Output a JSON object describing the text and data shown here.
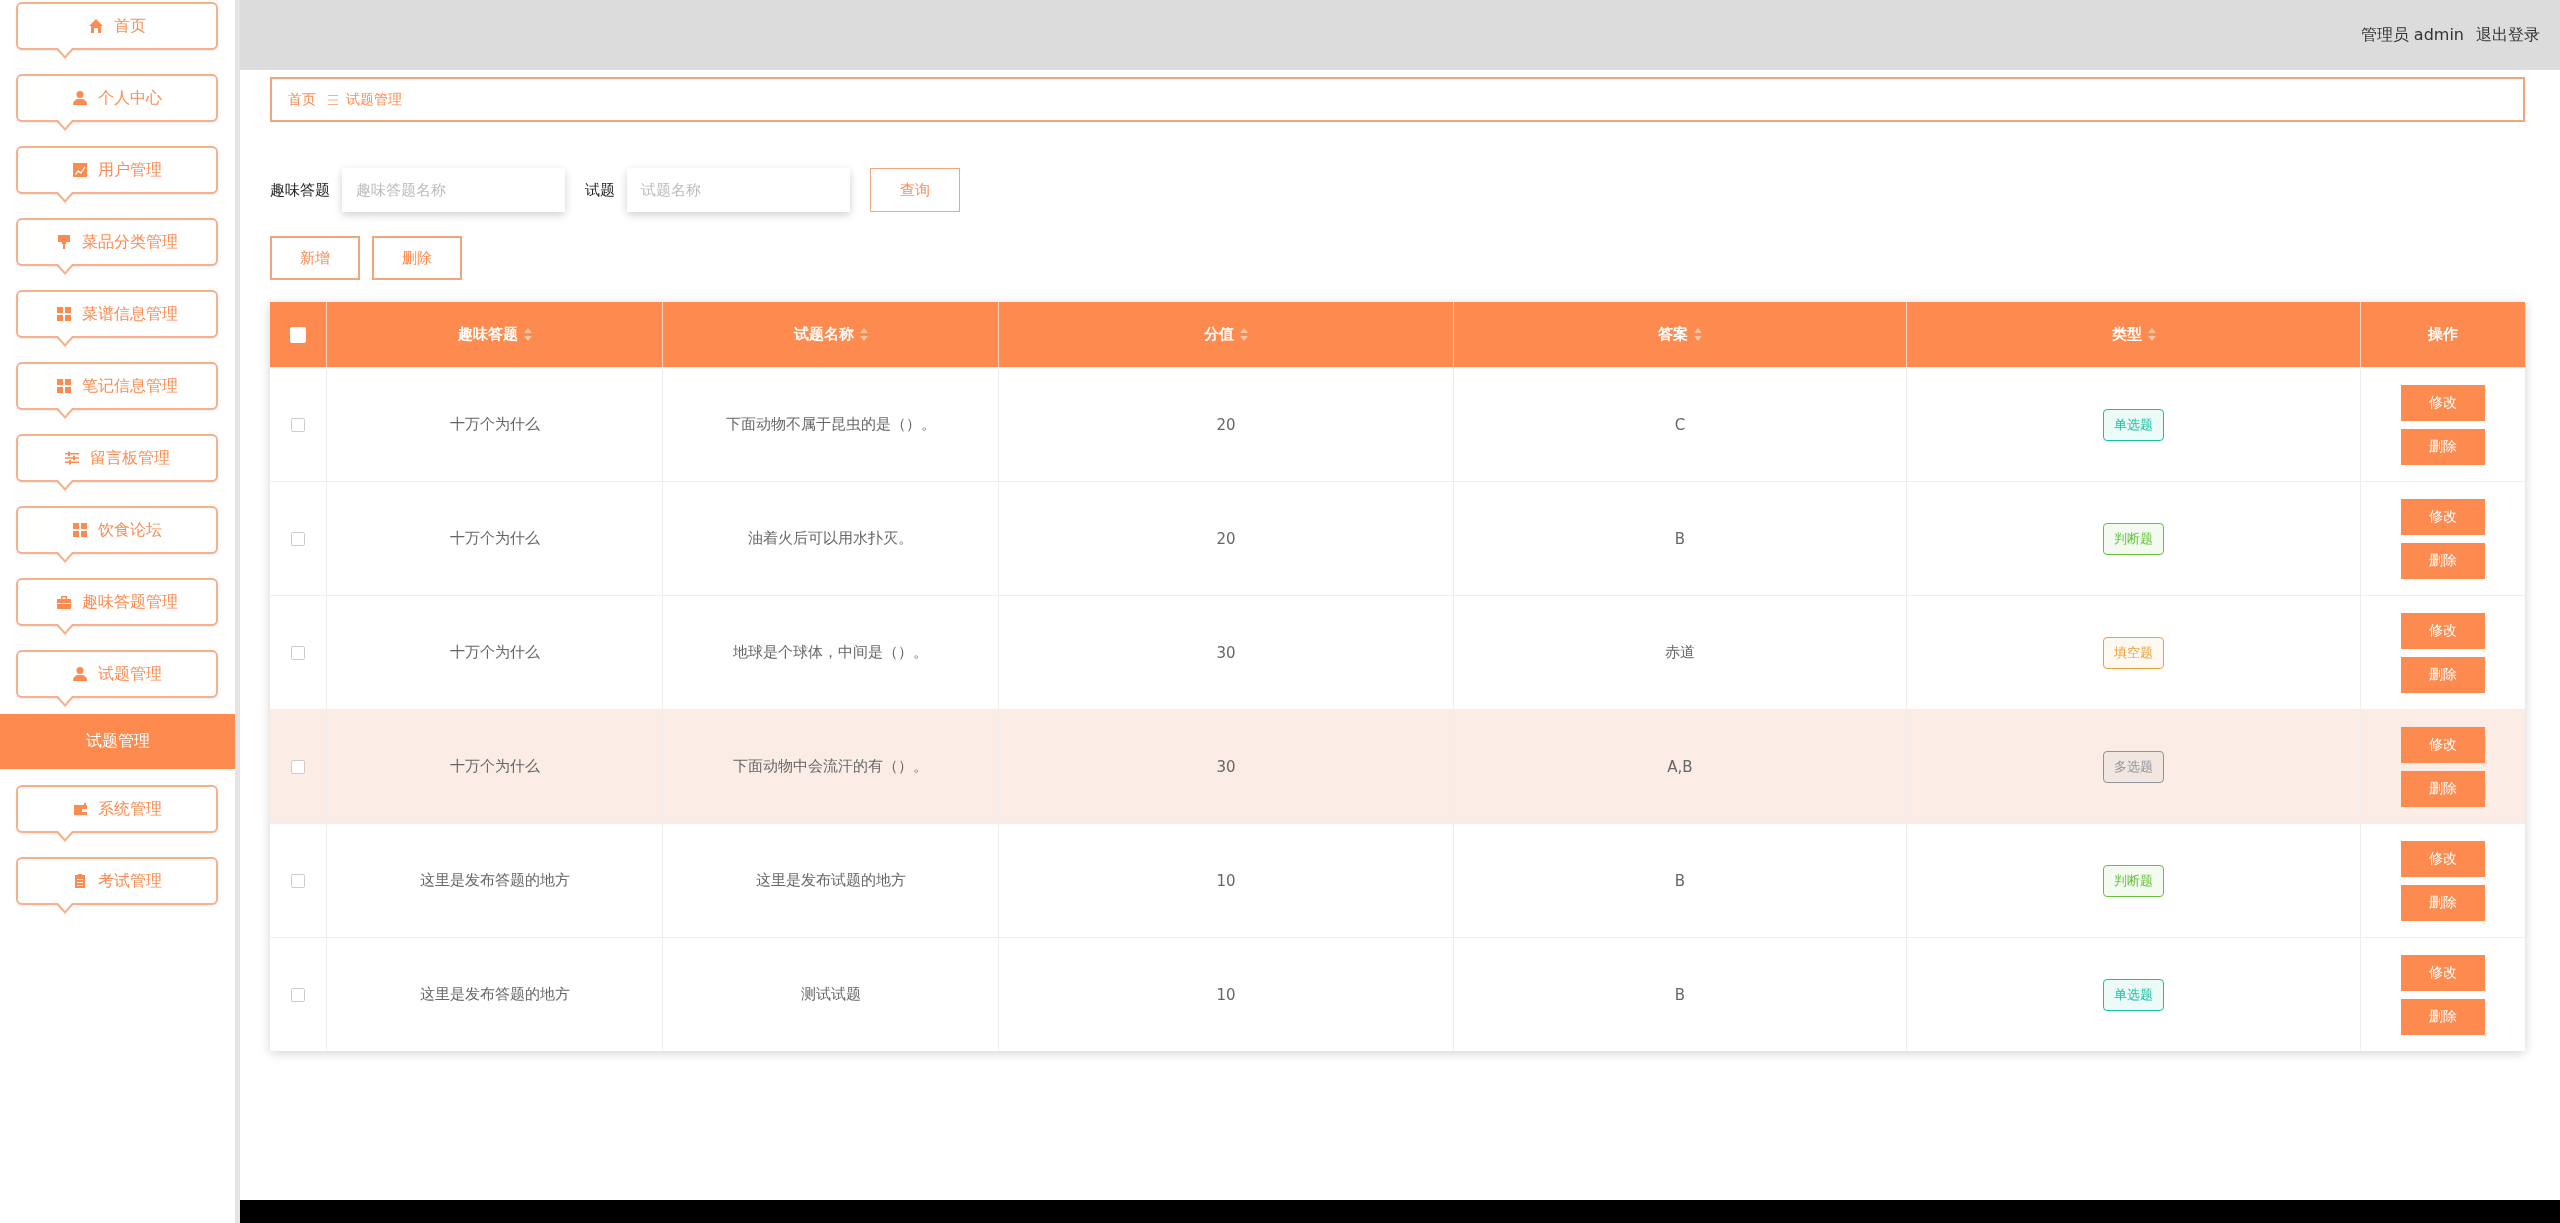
{
  "header": {
    "user_label": "管理员 admin",
    "logout": "退出登录"
  },
  "sidebar": {
    "items": [
      {
        "label": "首页",
        "kind": "home"
      },
      {
        "label": "个人中心",
        "kind": "user"
      },
      {
        "label": "用户管理",
        "kind": "chart"
      },
      {
        "label": "菜品分类管理",
        "kind": "brush"
      },
      {
        "label": "菜谱信息管理",
        "kind": "grid"
      },
      {
        "label": "笔记信息管理",
        "kind": "grid"
      },
      {
        "label": "留言板管理",
        "kind": "sliders"
      },
      {
        "label": "饮食论坛",
        "kind": "grid"
      },
      {
        "label": "趣味答题管理",
        "kind": "briefcase"
      },
      {
        "label": "试题管理",
        "kind": "user",
        "children": [
          {
            "label": "试题管理",
            "selected": true
          }
        ]
      },
      {
        "label": "系统管理",
        "kind": "wallet"
      },
      {
        "label": "考试管理",
        "kind": "clipboard"
      }
    ]
  },
  "breadcrumb": [
    "首页",
    "试题管理"
  ],
  "search": {
    "fields": [
      {
        "label": "趣味答题",
        "placeholder": "趣味答题名称"
      },
      {
        "label": "试题",
        "placeholder": "试题名称"
      }
    ],
    "button": "查询"
  },
  "actions": [
    "新增",
    "删除"
  ],
  "table": {
    "all_checked": false,
    "columns": [
      {
        "label": "趣味答题",
        "sortable": true
      },
      {
        "label": "试题名称",
        "sortable": true
      },
      {
        "label": "分值",
        "sortable": true
      },
      {
        "label": "答案",
        "sortable": true
      },
      {
        "label": "类型",
        "sortable": true
      },
      {
        "label": "操作",
        "sortable": false
      }
    ],
    "rows": [
      {
        "checked": false,
        "hovered": false,
        "cells": [
          "十万个为什么",
          "下面动物不属于昆虫的是（）。",
          "20",
          "C"
        ],
        "type": {
          "label": "单选题",
          "color": "#13c2a3"
        },
        "actions": [
          "修改",
          "删除"
        ]
      },
      {
        "checked": false,
        "hovered": false,
        "cells": [
          "十万个为什么",
          "油着火后可以用水扑灭。",
          "20",
          "B"
        ],
        "type": {
          "label": "判断题",
          "color": "#67c23a"
        },
        "actions": [
          "修改",
          "删除"
        ]
      },
      {
        "checked": false,
        "hovered": false,
        "cells": [
          "十万个为什么",
          "地球是个球体，中间是（）。",
          "30",
          "赤道"
        ],
        "type": {
          "label": "填空题",
          "color": "#e6a23c"
        },
        "actions": [
          "修改",
          "删除"
        ]
      },
      {
        "checked": false,
        "hovered": true,
        "cells": [
          "十万个为什么",
          "下面动物中会流汗的有（）。",
          "30",
          "A,B"
        ],
        "type": {
          "label": "多选题",
          "color": "#909399"
        },
        "actions": [
          "修改",
          "删除"
        ]
      },
      {
        "checked": false,
        "hovered": false,
        "cells": [
          "这里是发布答题的地方",
          "这里是发布试题的地方",
          "10",
          "B"
        ],
        "type": {
          "label": "判断题",
          "color": "#67c23a"
        },
        "actions": [
          "修改",
          "删除"
        ]
      },
      {
        "checked": false,
        "hovered": false,
        "cells": [
          "这里是发布答题的地方",
          "测试试题",
          "10",
          "B"
        ],
        "type": {
          "label": "单选题",
          "color": "#13c2a3"
        },
        "actions": [
          "修改",
          "删除"
        ]
      }
    ]
  }
}
